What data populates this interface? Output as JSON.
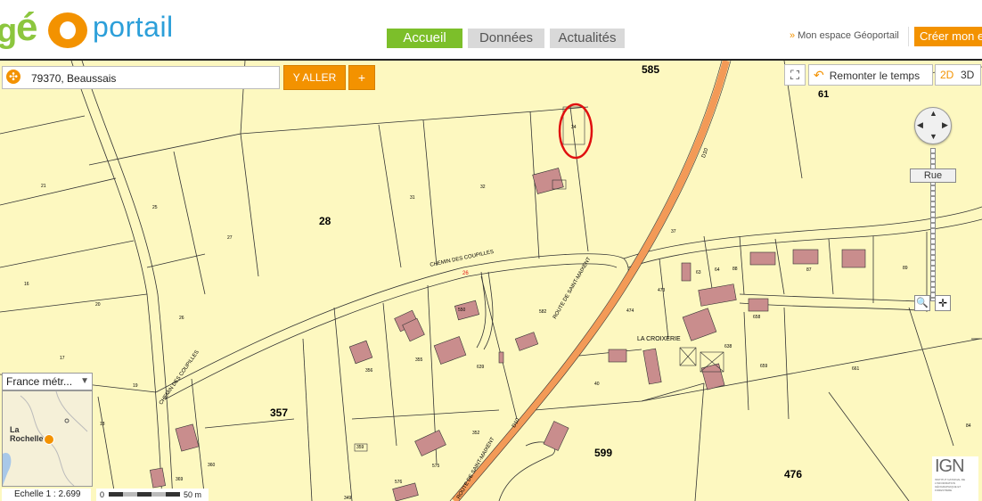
{
  "header": {
    "logo_prefix": "g",
    "logo_e": "é",
    "logo_suffix": "portail",
    "tabs": [
      {
        "label": "Accueil",
        "active": true
      },
      {
        "label": "Données",
        "active": false
      },
      {
        "label": "Actualités",
        "active": false
      }
    ],
    "account_link": "Mon espace Géoportail",
    "create_button": "Créer mon e"
  },
  "search": {
    "value": "79370, Beaussais",
    "go_label": "Y ALLER",
    "plus_label": "+"
  },
  "map_tools": {
    "remonter_label": "Remonter le temps",
    "view_2d": "2D",
    "view_3d": "3D",
    "zoom_level_label": "Rue"
  },
  "overview": {
    "region_select": "France métr...",
    "city_label_1": "La",
    "city_label_2": "Rochelle"
  },
  "scale": {
    "label": "Echelle 1 :  2.699",
    "bar_start": "0",
    "bar_end": "50 m"
  },
  "ign": {
    "logo_text": "IGN",
    "subtitle": "INSTITUT NATIONAL DE L'INFORMATION GÉOGRAPHIQUE ET FORESTIÈRE"
  },
  "map": {
    "parcel_labels": [
      "585",
      "61",
      "28",
      "357",
      "599",
      "476",
      "21",
      "25",
      "27",
      "31",
      "32",
      "34",
      "37",
      "16",
      "20",
      "26",
      "17",
      "19",
      "18",
      "582",
      "473",
      "474",
      "659",
      "661",
      "638",
      "658",
      "355",
      "356",
      "359",
      "360",
      "369",
      "352",
      "575",
      "576",
      "349",
      "40",
      "63",
      "64",
      "88",
      "87",
      "89",
      "84",
      "639",
      "550"
    ],
    "road_labels": [
      "CHEMIN DES COUPILLES",
      "CHEMIN DES COUPILLES",
      "ROUTE DE SAINT-MAIXENT",
      "ROUTE DE SAINT-MAIXENT",
      "D10",
      "D10",
      "LA CROIXERIE"
    ],
    "road_number": "26"
  },
  "colors": {
    "accent": "#f39200",
    "active_tab": "#7cbf2a",
    "map_bg": "#fdf8c0",
    "building": "#c98d8d",
    "road": "#f39a57",
    "highlight_circle": "#e01010"
  }
}
